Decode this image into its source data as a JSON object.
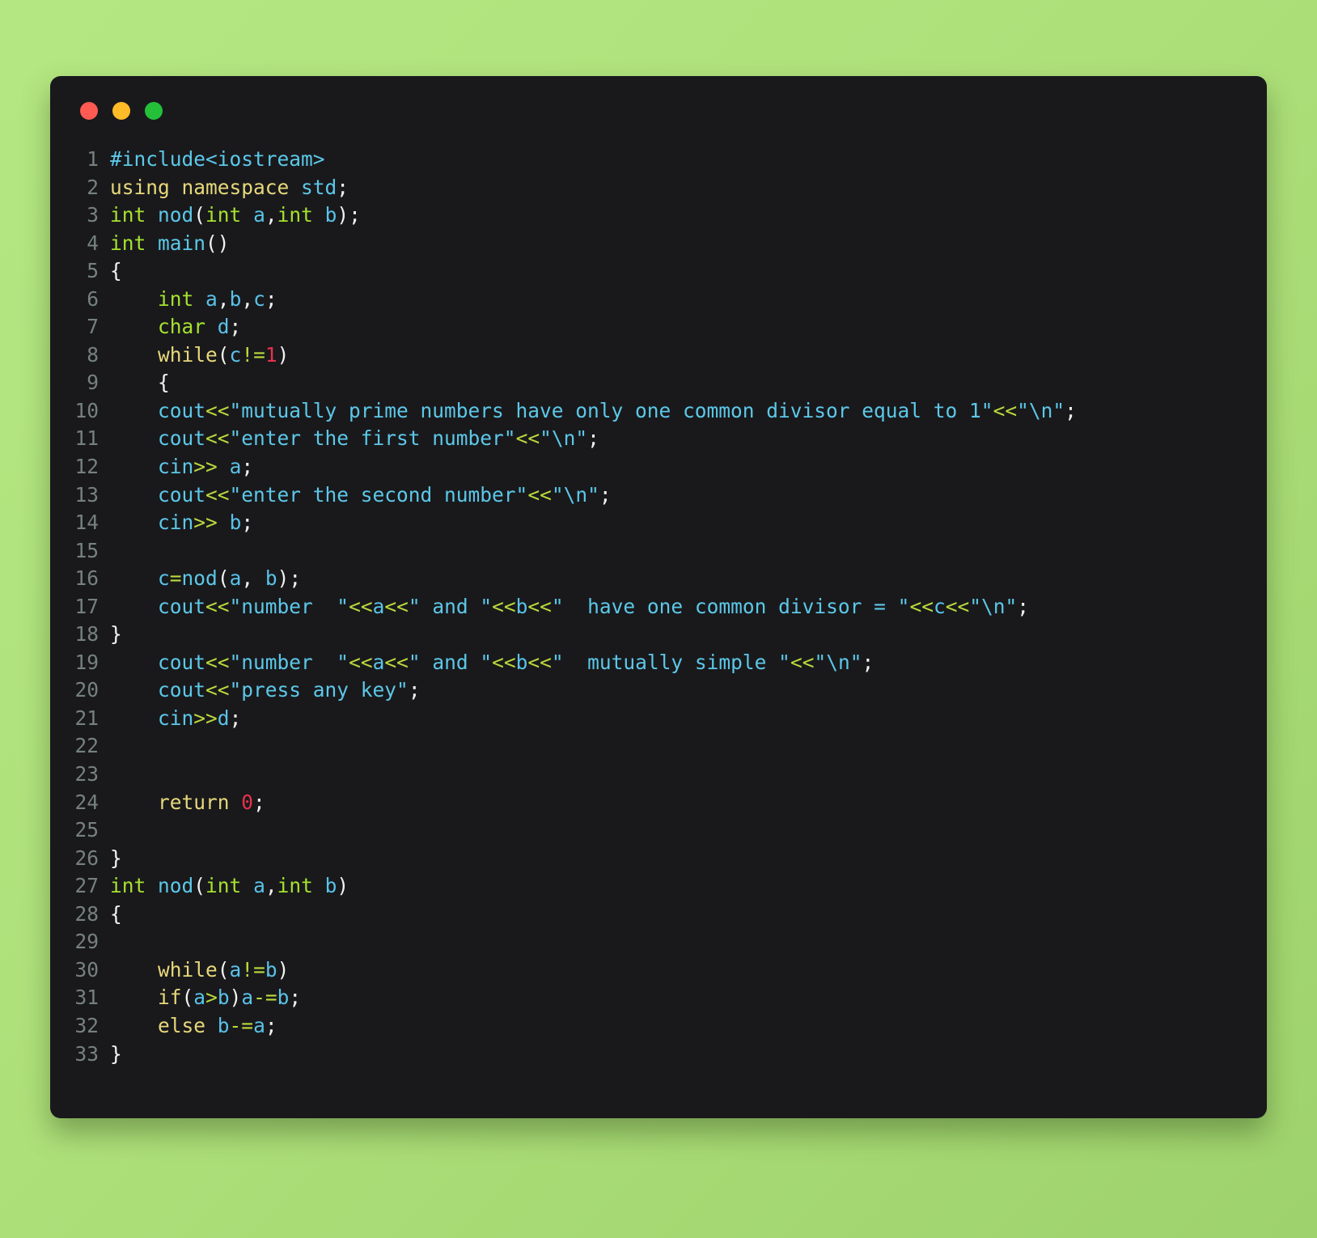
{
  "window": {
    "title": "",
    "controls": [
      {
        "name": "close-button",
        "color": "#ff5b52",
        "label": ""
      },
      {
        "name": "minimize-button",
        "color": "#ffbb28",
        "label": ""
      },
      {
        "name": "maximize-button",
        "color": "#24c03a",
        "label": ""
      }
    ]
  },
  "theme": {
    "page_background": "#aee27a",
    "card_background": "#19191c",
    "gutter_color": "#76817d",
    "keyword": "#e7d87a",
    "type": "#a6e22e",
    "function": "#5cc8e8",
    "variable": "#59c2e8",
    "string": "#5cc8e8",
    "operator": "#bada3c",
    "number": "#e8314a",
    "plain": "#f2f2f2"
  },
  "editor": {
    "language": "C++",
    "first_line_number": 1,
    "last_line_number": 33,
    "lines": [
      {
        "n": "1",
        "tokens": [
          {
            "t": "pre",
            "s": "#include<iostream>"
          }
        ]
      },
      {
        "n": "2",
        "tokens": [
          {
            "t": "key",
            "s": "using namespace "
          },
          {
            "t": "fn",
            "s": "std"
          },
          {
            "t": "plain",
            "s": ";"
          }
        ]
      },
      {
        "n": "3",
        "tokens": [
          {
            "t": "type",
            "s": "int "
          },
          {
            "t": "fn",
            "s": "nod"
          },
          {
            "t": "plain",
            "s": "("
          },
          {
            "t": "type",
            "s": "int "
          },
          {
            "t": "var",
            "s": "a"
          },
          {
            "t": "plain",
            "s": ","
          },
          {
            "t": "type",
            "s": "int "
          },
          {
            "t": "var",
            "s": "b"
          },
          {
            "t": "plain",
            "s": ");"
          }
        ]
      },
      {
        "n": "4",
        "tokens": [
          {
            "t": "type",
            "s": "int "
          },
          {
            "t": "fn",
            "s": "main"
          },
          {
            "t": "plain",
            "s": "()"
          }
        ]
      },
      {
        "n": "5",
        "tokens": [
          {
            "t": "plain",
            "s": "{"
          }
        ]
      },
      {
        "n": "6",
        "tokens": [
          {
            "t": "plain",
            "s": "    "
          },
          {
            "t": "type",
            "s": "int "
          },
          {
            "t": "var",
            "s": "a"
          },
          {
            "t": "plain",
            "s": ","
          },
          {
            "t": "var",
            "s": "b"
          },
          {
            "t": "plain",
            "s": ","
          },
          {
            "t": "var",
            "s": "c"
          },
          {
            "t": "plain",
            "s": ";"
          }
        ]
      },
      {
        "n": "7",
        "tokens": [
          {
            "t": "plain",
            "s": "    "
          },
          {
            "t": "type",
            "s": "char "
          },
          {
            "t": "var",
            "s": "d"
          },
          {
            "t": "plain",
            "s": ";"
          }
        ]
      },
      {
        "n": "8",
        "tokens": [
          {
            "t": "plain",
            "s": "    "
          },
          {
            "t": "key",
            "s": "while"
          },
          {
            "t": "plain",
            "s": "("
          },
          {
            "t": "var",
            "s": "c"
          },
          {
            "t": "op",
            "s": "!="
          },
          {
            "t": "num",
            "s": "1"
          },
          {
            "t": "plain",
            "s": ")"
          }
        ]
      },
      {
        "n": "9",
        "tokens": [
          {
            "t": "plain",
            "s": "    {"
          }
        ]
      },
      {
        "n": "10",
        "tokens": [
          {
            "t": "plain",
            "s": "    "
          },
          {
            "t": "fn",
            "s": "cout"
          },
          {
            "t": "op",
            "s": "<<"
          },
          {
            "t": "str",
            "s": "\"mutually prime numbers have only one common divisor equal to 1\""
          },
          {
            "t": "op",
            "s": "<<"
          },
          {
            "t": "str",
            "s": "\"\\n\""
          },
          {
            "t": "plain",
            "s": ";"
          }
        ]
      },
      {
        "n": "11",
        "tokens": [
          {
            "t": "plain",
            "s": "    "
          },
          {
            "t": "fn",
            "s": "cout"
          },
          {
            "t": "op",
            "s": "<<"
          },
          {
            "t": "str",
            "s": "\"enter the first number\""
          },
          {
            "t": "op",
            "s": "<<"
          },
          {
            "t": "str",
            "s": "\"\\n\""
          },
          {
            "t": "plain",
            "s": ";"
          }
        ]
      },
      {
        "n": "12",
        "tokens": [
          {
            "t": "plain",
            "s": "    "
          },
          {
            "t": "fn",
            "s": "cin"
          },
          {
            "t": "op",
            "s": ">>"
          },
          {
            "t": "plain",
            "s": " "
          },
          {
            "t": "var",
            "s": "a"
          },
          {
            "t": "plain",
            "s": ";"
          }
        ]
      },
      {
        "n": "13",
        "tokens": [
          {
            "t": "plain",
            "s": "    "
          },
          {
            "t": "fn",
            "s": "cout"
          },
          {
            "t": "op",
            "s": "<<"
          },
          {
            "t": "str",
            "s": "\"enter the second number\""
          },
          {
            "t": "op",
            "s": "<<"
          },
          {
            "t": "str",
            "s": "\"\\n\""
          },
          {
            "t": "plain",
            "s": ";"
          }
        ]
      },
      {
        "n": "14",
        "tokens": [
          {
            "t": "plain",
            "s": "    "
          },
          {
            "t": "fn",
            "s": "cin"
          },
          {
            "t": "op",
            "s": ">>"
          },
          {
            "t": "plain",
            "s": " "
          },
          {
            "t": "var",
            "s": "b"
          },
          {
            "t": "plain",
            "s": ";"
          }
        ]
      },
      {
        "n": "15",
        "tokens": [
          {
            "t": "plain",
            "s": ""
          }
        ]
      },
      {
        "n": "16",
        "tokens": [
          {
            "t": "plain",
            "s": "    "
          },
          {
            "t": "var",
            "s": "c"
          },
          {
            "t": "op",
            "s": "="
          },
          {
            "t": "fn",
            "s": "nod"
          },
          {
            "t": "plain",
            "s": "("
          },
          {
            "t": "var",
            "s": "a"
          },
          {
            "t": "plain",
            "s": ", "
          },
          {
            "t": "var",
            "s": "b"
          },
          {
            "t": "plain",
            "s": ");"
          }
        ]
      },
      {
        "n": "17",
        "tokens": [
          {
            "t": "plain",
            "s": "    "
          },
          {
            "t": "fn",
            "s": "cout"
          },
          {
            "t": "op",
            "s": "<<"
          },
          {
            "t": "str",
            "s": "\"number  \""
          },
          {
            "t": "op",
            "s": "<<"
          },
          {
            "t": "var",
            "s": "a"
          },
          {
            "t": "op",
            "s": "<<"
          },
          {
            "t": "str",
            "s": "\" and \""
          },
          {
            "t": "op",
            "s": "<<"
          },
          {
            "t": "var",
            "s": "b"
          },
          {
            "t": "op",
            "s": "<<"
          },
          {
            "t": "str",
            "s": "\"  have one common divisor = \""
          },
          {
            "t": "op",
            "s": "<<"
          },
          {
            "t": "var",
            "s": "c"
          },
          {
            "t": "op",
            "s": "<<"
          },
          {
            "t": "str",
            "s": "\"\\n\""
          },
          {
            "t": "plain",
            "s": ";"
          }
        ]
      },
      {
        "n": "18",
        "tokens": [
          {
            "t": "plain",
            "s": "}"
          }
        ]
      },
      {
        "n": "19",
        "tokens": [
          {
            "t": "plain",
            "s": "    "
          },
          {
            "t": "fn",
            "s": "cout"
          },
          {
            "t": "op",
            "s": "<<"
          },
          {
            "t": "str",
            "s": "\"number  \""
          },
          {
            "t": "op",
            "s": "<<"
          },
          {
            "t": "var",
            "s": "a"
          },
          {
            "t": "op",
            "s": "<<"
          },
          {
            "t": "str",
            "s": "\" and \""
          },
          {
            "t": "op",
            "s": "<<"
          },
          {
            "t": "var",
            "s": "b"
          },
          {
            "t": "op",
            "s": "<<"
          },
          {
            "t": "str",
            "s": "\"  mutually simple \""
          },
          {
            "t": "op",
            "s": "<<"
          },
          {
            "t": "str",
            "s": "\"\\n\""
          },
          {
            "t": "plain",
            "s": ";"
          }
        ]
      },
      {
        "n": "20",
        "tokens": [
          {
            "t": "plain",
            "s": "    "
          },
          {
            "t": "fn",
            "s": "cout"
          },
          {
            "t": "op",
            "s": "<<"
          },
          {
            "t": "str",
            "s": "\"press any key\""
          },
          {
            "t": "plain",
            "s": ";"
          }
        ]
      },
      {
        "n": "21",
        "tokens": [
          {
            "t": "plain",
            "s": "    "
          },
          {
            "t": "fn",
            "s": "cin"
          },
          {
            "t": "op",
            "s": ">>"
          },
          {
            "t": "var",
            "s": "d"
          },
          {
            "t": "plain",
            "s": ";"
          }
        ]
      },
      {
        "n": "22",
        "tokens": [
          {
            "t": "plain",
            "s": ""
          }
        ]
      },
      {
        "n": "23",
        "tokens": [
          {
            "t": "plain",
            "s": ""
          }
        ]
      },
      {
        "n": "24",
        "tokens": [
          {
            "t": "plain",
            "s": "    "
          },
          {
            "t": "key",
            "s": "return "
          },
          {
            "t": "num",
            "s": "0"
          },
          {
            "t": "plain",
            "s": ";"
          }
        ]
      },
      {
        "n": "25",
        "tokens": [
          {
            "t": "plain",
            "s": ""
          }
        ]
      },
      {
        "n": "26",
        "tokens": [
          {
            "t": "plain",
            "s": "}"
          }
        ]
      },
      {
        "n": "27",
        "tokens": [
          {
            "t": "type",
            "s": "int "
          },
          {
            "t": "fn",
            "s": "nod"
          },
          {
            "t": "plain",
            "s": "("
          },
          {
            "t": "type",
            "s": "int "
          },
          {
            "t": "var",
            "s": "a"
          },
          {
            "t": "plain",
            "s": ","
          },
          {
            "t": "type",
            "s": "int "
          },
          {
            "t": "var",
            "s": "b"
          },
          {
            "t": "plain",
            "s": ")"
          }
        ]
      },
      {
        "n": "28",
        "tokens": [
          {
            "t": "plain",
            "s": "{"
          }
        ]
      },
      {
        "n": "29",
        "tokens": [
          {
            "t": "plain",
            "s": ""
          }
        ]
      },
      {
        "n": "30",
        "tokens": [
          {
            "t": "plain",
            "s": "    "
          },
          {
            "t": "key",
            "s": "while"
          },
          {
            "t": "plain",
            "s": "("
          },
          {
            "t": "var",
            "s": "a"
          },
          {
            "t": "op",
            "s": "!="
          },
          {
            "t": "var",
            "s": "b"
          },
          {
            "t": "plain",
            "s": ")"
          }
        ]
      },
      {
        "n": "31",
        "tokens": [
          {
            "t": "plain",
            "s": "    "
          },
          {
            "t": "key",
            "s": "if"
          },
          {
            "t": "plain",
            "s": "("
          },
          {
            "t": "var",
            "s": "a"
          },
          {
            "t": "op",
            "s": ">"
          },
          {
            "t": "var",
            "s": "b"
          },
          {
            "t": "plain",
            "s": ")"
          },
          {
            "t": "var",
            "s": "a"
          },
          {
            "t": "op",
            "s": "-="
          },
          {
            "t": "var",
            "s": "b"
          },
          {
            "t": "plain",
            "s": ";"
          }
        ]
      },
      {
        "n": "32",
        "tokens": [
          {
            "t": "plain",
            "s": "    "
          },
          {
            "t": "key",
            "s": "else "
          },
          {
            "t": "var",
            "s": "b"
          },
          {
            "t": "op",
            "s": "-="
          },
          {
            "t": "var",
            "s": "a"
          },
          {
            "t": "plain",
            "s": ";"
          }
        ]
      },
      {
        "n": "33",
        "tokens": [
          {
            "t": "plain",
            "s": "}"
          }
        ]
      }
    ]
  }
}
